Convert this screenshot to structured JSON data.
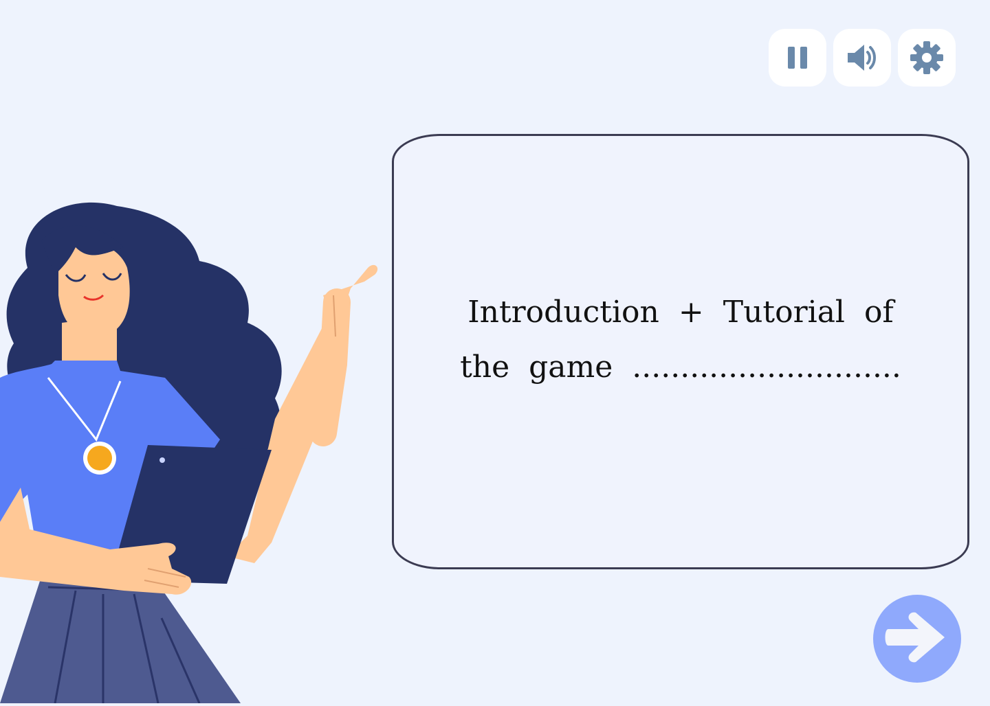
{
  "controls": {
    "pause_icon": "pause-icon",
    "sound_icon": "speaker-icon",
    "settings_icon": "gear-icon",
    "icon_color": "#6a89aa"
  },
  "dialog": {
    "text": "Introduction + Tutorial of the game ............................"
  },
  "next_button": {
    "icon": "arrow-right-icon",
    "color": "#8fa9fc"
  },
  "character": {
    "description_icon": "teacher-illustration"
  }
}
